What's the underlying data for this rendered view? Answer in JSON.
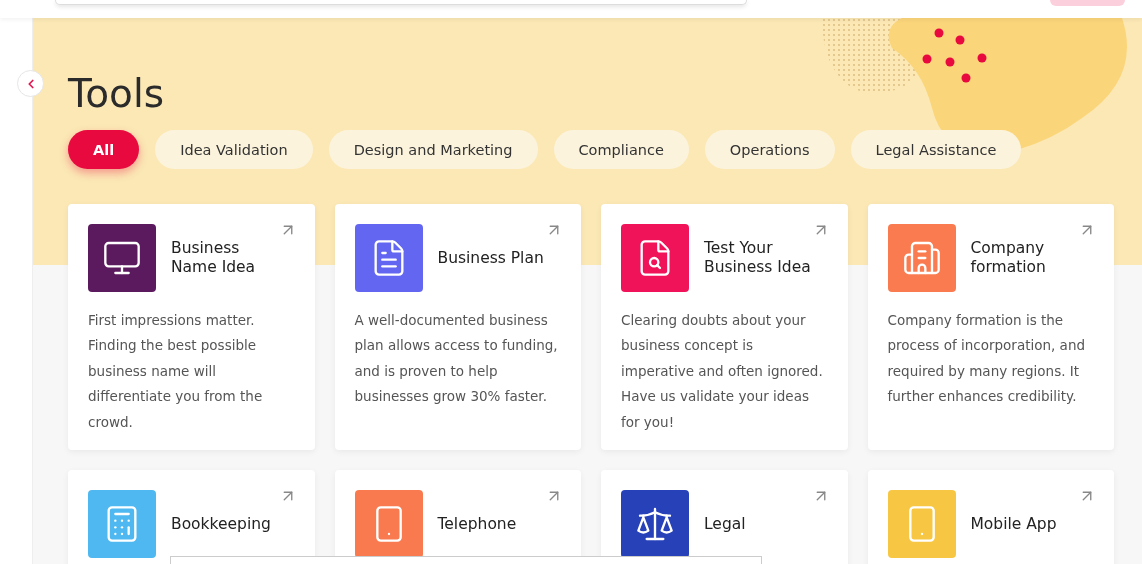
{
  "page": {
    "title": "Tools"
  },
  "filters": [
    {
      "label": "All",
      "selected": true
    },
    {
      "label": "Idea Validation",
      "selected": false
    },
    {
      "label": "Design and Marketing",
      "selected": false
    },
    {
      "label": "Compliance",
      "selected": false
    },
    {
      "label": "Operations",
      "selected": false
    },
    {
      "label": "Legal Assistance",
      "selected": false
    }
  ],
  "cards": [
    {
      "kind": "monitor",
      "color": "#5c1a5e",
      "title": "Business Name Idea",
      "description": "First impressions matter. Finding the best possible business name will differentiate you from the crowd."
    },
    {
      "kind": "plan",
      "color": "#6366f1",
      "title": "Business Plan",
      "description": "A well-documented business plan allows access to funding, and is proven to help businesses grow 30% faster."
    },
    {
      "kind": "search",
      "color": "#f0135a",
      "title": "Test Your Business Idea",
      "description": "Clearing doubts about your business concept is imperative and often ignored. Have us validate your ideas for you!"
    },
    {
      "kind": "building",
      "color": "#fa7b4f",
      "title": "Company formation",
      "description": "Company formation is the process of incorporation, and required by many regions. It further enhances credibility."
    },
    {
      "kind": "calculator",
      "color": "#4fb8f0",
      "title": "Bookkeeping"
    },
    {
      "kind": "phone",
      "color": "#f97a4e",
      "title": "Telephone"
    },
    {
      "kind": "scales",
      "color": "#2741b8",
      "title": "Legal"
    },
    {
      "kind": "mobile",
      "color": "#f7c744",
      "title": "Mobile App"
    }
  ]
}
